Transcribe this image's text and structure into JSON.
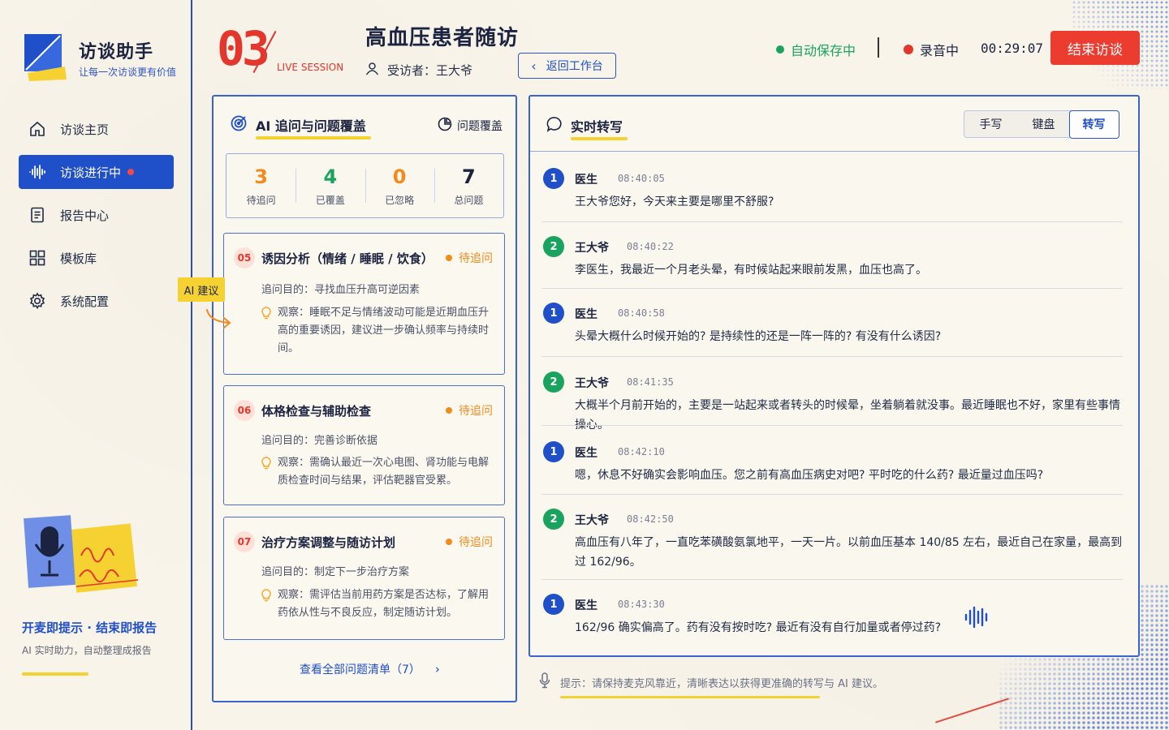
{
  "brand": {
    "title": "访谈助手",
    "subtitle": "让每一次访谈更有价值"
  },
  "sidebar": {
    "items": [
      {
        "label": "访谈主页",
        "icon": "home-icon"
      },
      {
        "label": "访谈进行中",
        "icon": "waveform-icon",
        "active": true
      },
      {
        "label": "报告中心",
        "icon": "document-icon"
      },
      {
        "label": "模板库",
        "icon": "template-icon"
      },
      {
        "label": "系统配置",
        "icon": "gear-icon"
      }
    ],
    "promo_title": "开麦即提示 · 结束即报告",
    "promo_subtitle": "AI 实时助力，自动整理成报告"
  },
  "header": {
    "session_number": "03",
    "live_label": "LIVE SESSION",
    "title": "高血压患者随访",
    "interviewee_label": "受访者：王大爷",
    "back_button": "返回工作台",
    "autosave": "自动保存中",
    "recording": "录音中",
    "timer": "00:29:07",
    "end_button": "结束访谈"
  },
  "ai_panel": {
    "title": "AI 追问与问题覆盖",
    "coverage_link": "问题覆盖",
    "stats": [
      {
        "value": "3",
        "label": "待追问",
        "color": "#f28a1c"
      },
      {
        "value": "4",
        "label": "已覆盖",
        "color": "#1aa35f"
      },
      {
        "value": "0",
        "label": "已忽略",
        "color": "#f28a1c"
      },
      {
        "value": "7",
        "label": "总问题",
        "color": "#1b2340"
      }
    ],
    "ai_tag": "AI 建议",
    "questions": [
      {
        "num": "05",
        "title": "诱因分析（情绪 / 睡眠 / 饮食）",
        "status": "待追问",
        "purpose": "追问目的：寻找血压升高可逆因素",
        "observation": "观察：睡眠不足与情绪波动可能是近期血压升高的重要诱因，建议进一步确认频率与持续时间。"
      },
      {
        "num": "06",
        "title": "体格检查与辅助检查",
        "status": "待追问",
        "purpose": "追问目的：完善诊断依据",
        "observation": "观察：需确认最近一次心电图、肾功能与电解质检查时间与结果，评估靶器官受累。"
      },
      {
        "num": "07",
        "title": "治疗方案调整与随访计划",
        "status": "待追问",
        "purpose": "追问目的：制定下一步治疗方案",
        "observation": "观察：需评估当前用药方案是否达标，了解用药依从性与不良反应，制定随访计划。"
      }
    ],
    "view_all": "查看全部问题清单（7）"
  },
  "transcript": {
    "title": "实时转写",
    "modes": [
      "手写",
      "键盘",
      "转写"
    ],
    "active_mode": "转写",
    "messages": [
      {
        "avatar": "1",
        "speaker": "医生",
        "time": "08:40:05",
        "text": "王大爷您好，今天来主要是哪里不舒服?"
      },
      {
        "avatar": "2",
        "speaker": "王大爷",
        "time": "08:40:22",
        "text": "李医生，我最近一个月老头晕，有时候站起来眼前发黑，血压也高了。"
      },
      {
        "avatar": "1",
        "speaker": "医生",
        "time": "08:40:58",
        "text": "头晕大概什么时候开始的? 是持续性的还是一阵一阵的? 有没有什么诱因?"
      },
      {
        "avatar": "2",
        "speaker": "王大爷",
        "time": "08:41:35",
        "text": "大概半个月前开始的，主要是一站起来或者转头的时候晕，坐着躺着就没事。最近睡眠也不好，家里有些事情操心。"
      },
      {
        "avatar": "1",
        "speaker": "医生",
        "time": "08:42:10",
        "text": "嗯，休息不好确实会影响血压。您之前有高血压病史对吧? 平时吃的什么药? 最近量过血压吗?"
      },
      {
        "avatar": "2",
        "speaker": "王大爷",
        "time": "08:42:50",
        "text": "高血压有八年了，一直吃苯磺酸氨氯地平，一天一片。以前血压基本 140/85 左右，最近自己在家量，最高到过 162/96。"
      },
      {
        "avatar": "1",
        "speaker": "医生",
        "time": "08:43:30",
        "text": "162/96 确实偏高了。药有没有按时吃? 最近有没有自行加量或者停过药?"
      }
    ],
    "hint": "提示：请保持麦克风靠近，清晰表达以获得更准确的转写与 AI 建议。"
  },
  "colors": {
    "accent_blue": "#1f4fc9",
    "accent_red": "#e3372d",
    "highlight_yellow": "#f5d232",
    "pending_orange": "#f28a1c",
    "success_green": "#1aa35f"
  }
}
